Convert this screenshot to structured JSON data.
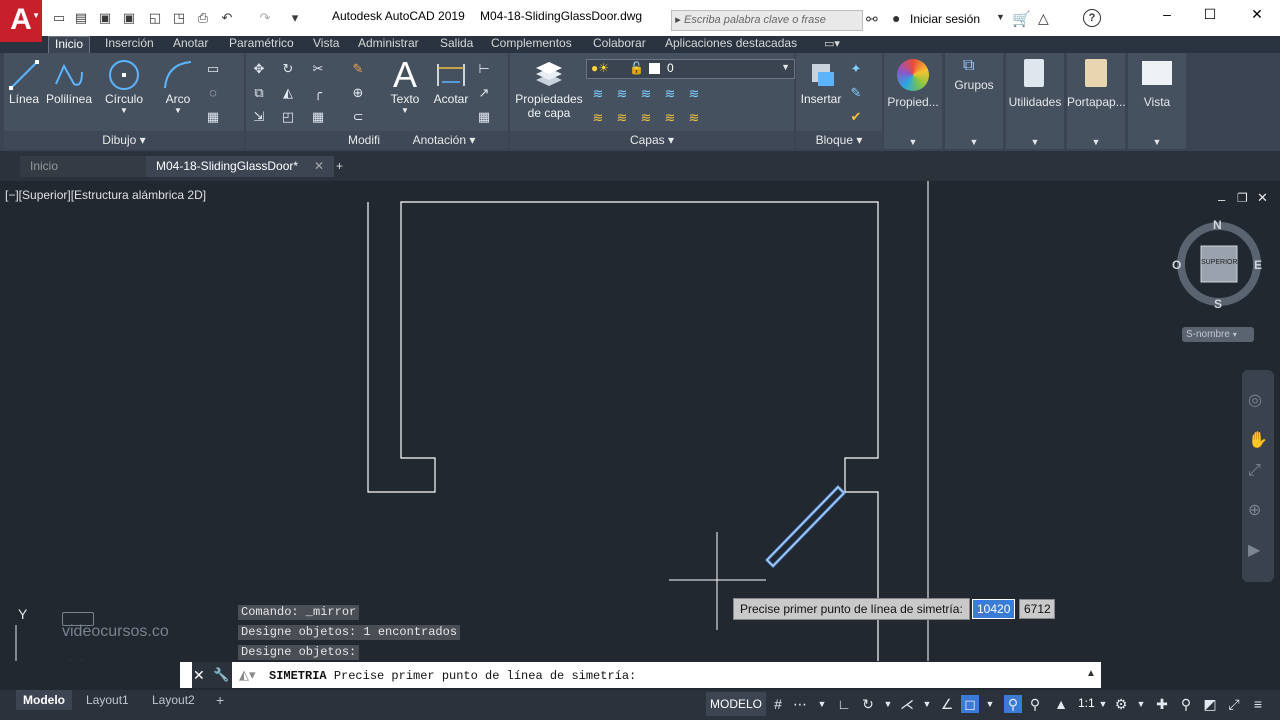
{
  "window": {
    "app_title": "Autodesk AutoCAD 2019",
    "doc_title": "M04-18-SlidingGlassDoor.dwg",
    "search_placeholder": "Escriba palabra clave o frase",
    "signin_label": "Iniciar sesión",
    "minimize": "–",
    "maximize": "☐",
    "close": "✕"
  },
  "ribbon_tabs": [
    "Inicio",
    "Inserción",
    "Anotar",
    "Paramétrico",
    "Vista",
    "Administrar",
    "Salida",
    "Complementos",
    "Colaborar",
    "Aplicaciones destacadas"
  ],
  "ribbon": {
    "dibujo": {
      "title": "Dibujo",
      "tools": [
        "Línea",
        "Polilínea",
        "Círculo",
        "Arco"
      ]
    },
    "modificar": {
      "title": "Modificar"
    },
    "anotacion": {
      "title": "Anotación",
      "tools": [
        "Texto",
        "Acotar"
      ]
    },
    "capas": {
      "title": "Capas",
      "layer_props_line1": "Propiedades",
      "layer_props_line2": "de capa",
      "current_layer": "0"
    },
    "bloque": {
      "title": "Bloque",
      "insert": "Insertar"
    },
    "propiedades": "Propied...",
    "grupos": "Grupos",
    "utilidades": "Utilidades",
    "portapapeles": "Portapap...",
    "vista": "Vista"
  },
  "file_tabs": {
    "start": "Inicio",
    "active": "M04-18-SlidingGlassDoor*",
    "add": "+"
  },
  "viewport": {
    "label": "[−][Superior][Estructura alámbrica 2D]",
    "viewcube_face": "SUPERIOR",
    "compass": {
      "n": "N",
      "s": "S",
      "e": "E",
      "w": "O"
    },
    "ucs_menu": "S-nombre",
    "ucs_y": "Y",
    "watermark": "videocursos.co"
  },
  "command_history": [
    "Comando: _mirror",
    "Designe objetos: 1 encontrados",
    "Designe objetos:"
  ],
  "command_line": {
    "command": "SIMETRIA",
    "prompt": "Precise primer punto de línea de simetría:"
  },
  "tooltip": {
    "prompt": "Precise primer punto de línea de simetría:",
    "x": "10420",
    "y": "6712"
  },
  "layout_tabs": [
    "Modelo",
    "Layout1",
    "Layout2"
  ],
  "status": {
    "model": "MODELO",
    "scale": "1:1"
  }
}
